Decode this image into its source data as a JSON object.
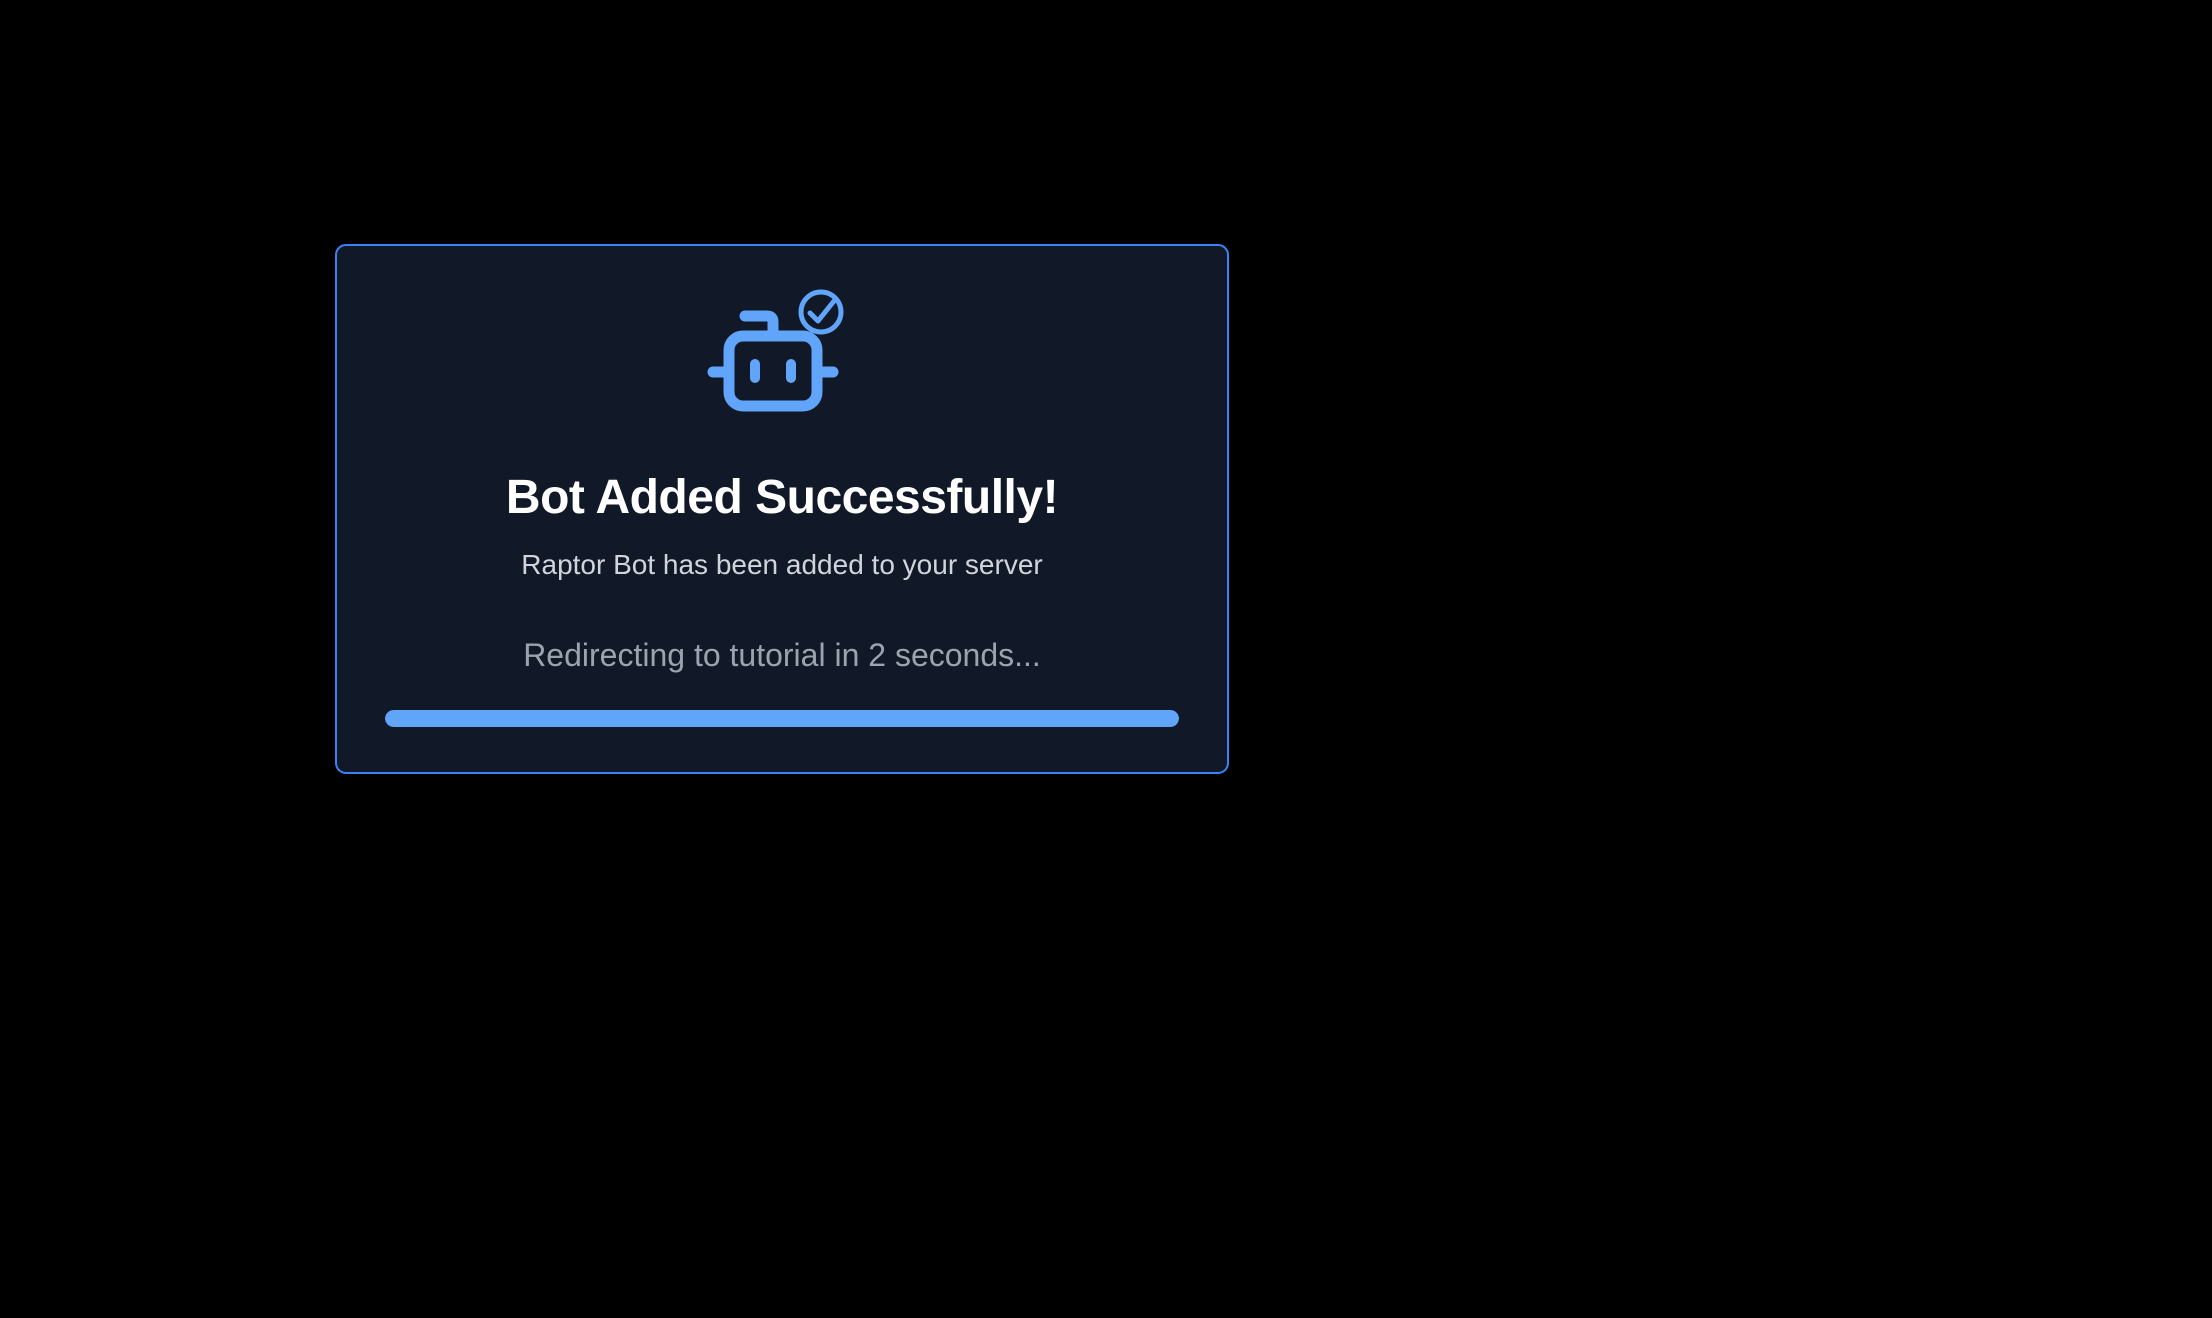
{
  "dialog": {
    "icon": "robot-check-icon",
    "title": "Bot Added Successfully!",
    "subtitle": "Raptor Bot has been added to your server",
    "redirect_text": "Redirecting to tutorial in 2 seconds...",
    "progress": 1.0
  },
  "colors": {
    "background": "#000000",
    "card_background": "#111827",
    "accent": "#60a5fa",
    "border": "#3b82f6",
    "title": "#ffffff",
    "subtitle": "#d1d5db",
    "muted": "#9ca3af"
  }
}
